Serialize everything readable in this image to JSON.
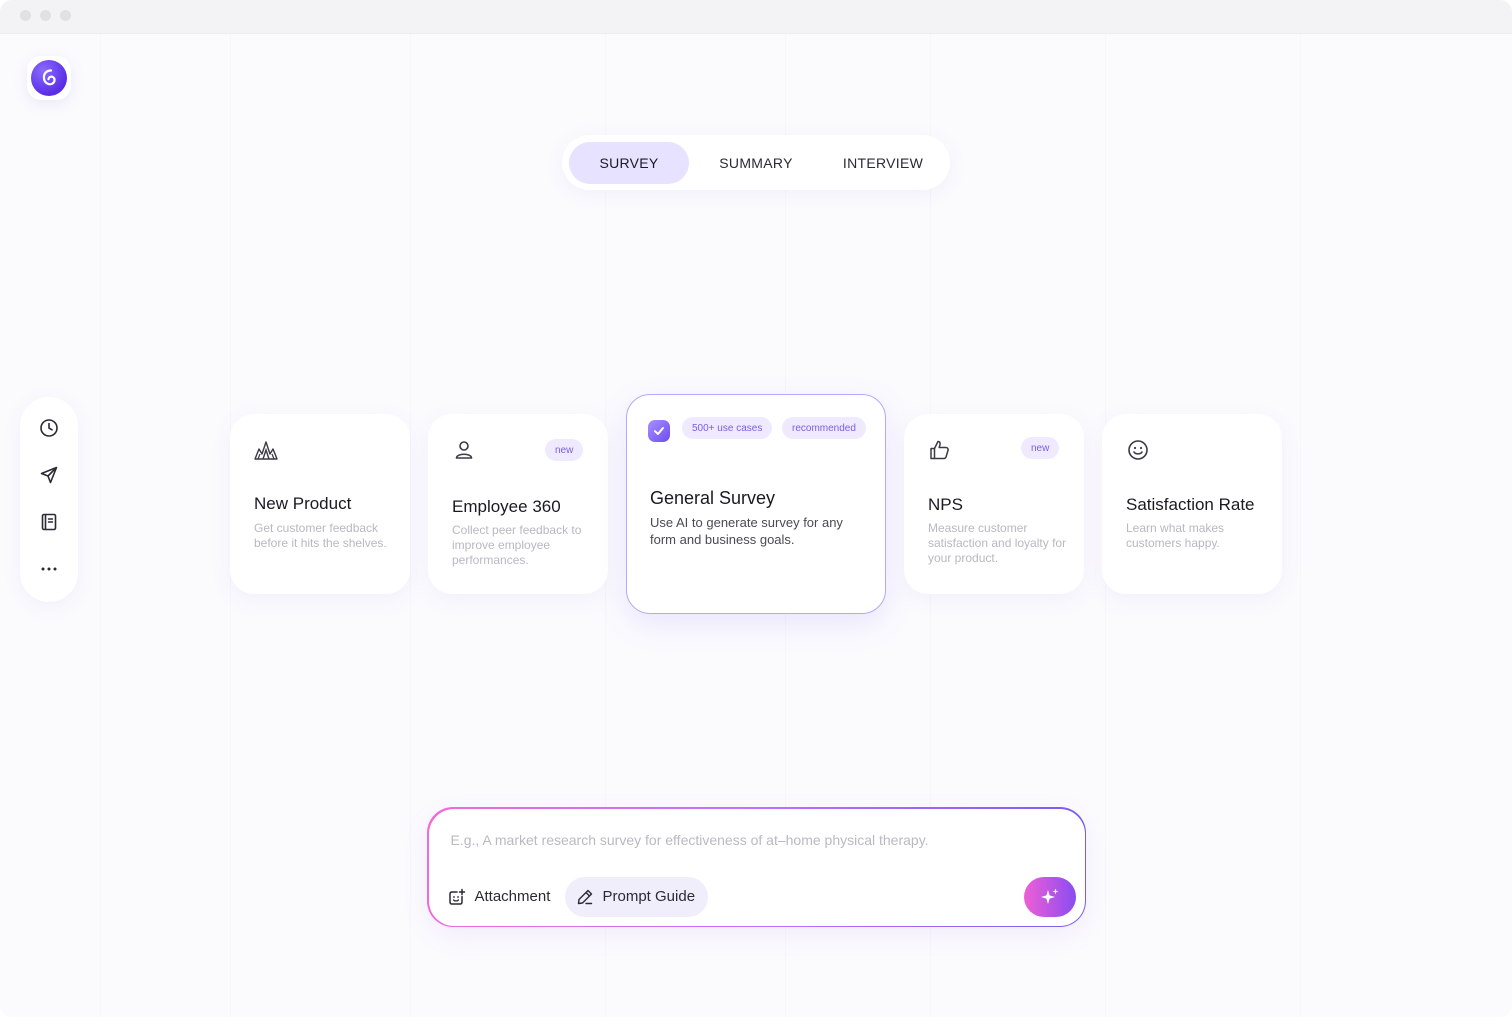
{
  "tabs": [
    {
      "label": "SURVEY",
      "active": true
    },
    {
      "label": "SUMMARY",
      "active": false
    },
    {
      "label": "INTERVIEW",
      "active": false
    }
  ],
  "sidebar": {
    "items": [
      {
        "icon": "clock-icon"
      },
      {
        "icon": "send-icon"
      },
      {
        "icon": "notebook-icon"
      },
      {
        "icon": "more-icon"
      }
    ]
  },
  "cards": [
    {
      "icon": "mountains-icon",
      "title": "New Product",
      "description": "Get customer feedback before it hits the shelves."
    },
    {
      "icon": "user-icon",
      "badge": "new",
      "title": "Employee 360",
      "description": "Collect peer feedback to improve employee performances."
    },
    {
      "icon": "check-icon",
      "badges": [
        "500+ use cases",
        "recommended"
      ],
      "title": "General Survey",
      "description": "Use AI to generate survey for any form and business goals."
    },
    {
      "icon": "thumbs-up-icon",
      "badge": "new",
      "title": "NPS",
      "description": "Measure customer satisfaction and loyalty for your product."
    },
    {
      "icon": "smile-icon",
      "title": "Satisfaction Rate",
      "description": "Learn what makes customers happy."
    }
  ],
  "prompt": {
    "placeholder": "E.g., A market research survey for effectiveness of at–home physical therapy.",
    "attachment_label": "Attachment",
    "guide_label": "Prompt Guide"
  },
  "colors": {
    "accent": "#7c5ce6",
    "active_tab": "#e7e2ff",
    "gradient_start": "#ee5fd6",
    "gradient_end": "#8a4cf2"
  }
}
